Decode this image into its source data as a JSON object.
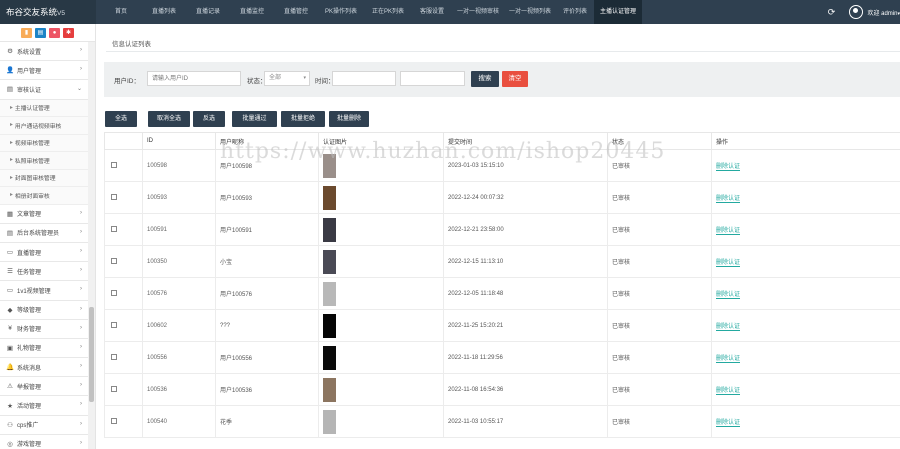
{
  "brand": {
    "name": "布谷交友系统",
    "version": "V5"
  },
  "topnav": [
    {
      "label": "首页",
      "width": 42
    },
    {
      "label": "直播列表",
      "width": 44
    },
    {
      "label": "直播记录",
      "width": 44
    },
    {
      "label": "直播监控",
      "width": 44
    },
    {
      "label": "直播管控",
      "width": 44
    },
    {
      "label": "PK操作列表",
      "width": 46
    },
    {
      "label": "正在PK列表",
      "width": 48
    },
    {
      "label": "客服设置",
      "width": 40
    },
    {
      "label": "一对一视频审核",
      "width": 52
    },
    {
      "label": "一对一视频列表",
      "width": 52
    },
    {
      "label": "评价列表",
      "width": 38
    },
    {
      "label": "主播认证管理",
      "width": 48,
      "active": true
    }
  ],
  "header": {
    "welcome": "欢迎 admin"
  },
  "sidebar": {
    "top_menu": [
      {
        "label": "系统设置",
        "icon": "⚙"
      },
      {
        "label": "用户管理",
        "icon": "👤"
      },
      {
        "label": "审核认证",
        "icon": "▤"
      }
    ],
    "submenu": [
      "主播认证管理",
      "用户通话视频审核",
      "视频审核管理",
      "私照审核管理",
      "封面图审核管理",
      "相册封面审核"
    ],
    "bottom_menu": [
      {
        "label": "文章管理",
        "icon": "▦"
      },
      {
        "label": "后台系统管理员",
        "icon": "▤"
      },
      {
        "label": "直播管理",
        "icon": "▭"
      },
      {
        "label": "任务管理",
        "icon": "☰"
      },
      {
        "label": "1v1视频管理",
        "icon": "▭"
      },
      {
        "label": "等级管理",
        "icon": "◆"
      },
      {
        "label": "财务管理",
        "icon": "¥"
      },
      {
        "label": "礼物管理",
        "icon": "▣"
      },
      {
        "label": "系统消息",
        "icon": "🔔"
      },
      {
        "label": "举报管理",
        "icon": "⚠"
      },
      {
        "label": "活动管理",
        "icon": "★"
      },
      {
        "label": "cps推广",
        "icon": "⚇"
      },
      {
        "label": "游戏管理",
        "icon": "◎"
      }
    ]
  },
  "panel": {
    "title": "信息认证列表"
  },
  "filter": {
    "uid_label": "用户ID：",
    "uid_placeholder": "请输入用户ID",
    "status_label": "状态：",
    "status_value": "全部",
    "time_label": "时间：",
    "search_label": "搜索",
    "clear_label": "清空"
  },
  "actions": [
    "全选",
    "取消全选",
    "反选",
    "批量通过",
    "批量拒绝",
    "批量删除"
  ],
  "table": {
    "headers": [
      "",
      "ID",
      "用户昵称",
      "认证图片",
      "提交时间",
      "状态",
      "操作"
    ],
    "rows": [
      {
        "id": "100598",
        "nick": "用户100598",
        "time": "2023-01-03 15:15:10",
        "status": "已审核",
        "op": "删除认证",
        "thumb": "#9a8f8a"
      },
      {
        "id": "100593",
        "nick": "用户100593",
        "time": "2022-12-24 00:07:32",
        "status": "已审核",
        "op": "删除认证",
        "thumb": "#6b4a2e"
      },
      {
        "id": "100591",
        "nick": "用户100591",
        "time": "2022-12-21 23:58:00",
        "status": "已审核",
        "op": "删除认证",
        "thumb": "#3a3a44"
      },
      {
        "id": "100350",
        "nick": "小宝",
        "time": "2022-12-15 11:13:10",
        "status": "已审核",
        "op": "删除认证",
        "thumb": "#4a4a55"
      },
      {
        "id": "100576",
        "nick": "用户100576",
        "time": "2022-12-05 11:18:48",
        "status": "已审核",
        "op": "删除认证",
        "thumb": "#b8b8b8"
      },
      {
        "id": "100602",
        "nick": "???",
        "time": "2022-11-25 15:20:21",
        "status": "已审核",
        "op": "删除认证",
        "thumb": "#050505"
      },
      {
        "id": "100556",
        "nick": "用户100556",
        "time": "2022-11-18 11:29:56",
        "status": "已审核",
        "op": "删除认证",
        "thumb": "#0a0a0a"
      },
      {
        "id": "100536",
        "nick": "用户100536",
        "time": "2022-11-08 16:54:36",
        "status": "已审核",
        "op": "删除认证",
        "thumb": "#8c7560"
      },
      {
        "id": "100540",
        "nick": "花季",
        "time": "2022-11-03 10:55:17",
        "status": "已审核",
        "op": "删除认证",
        "thumb": "#b5b5b5"
      }
    ]
  },
  "watermark": "https://www.huzhan.com/ishop20445",
  "colors": {
    "nav": "#2f4050",
    "accent_red": "#e94f3f",
    "link": "#23a9a0"
  }
}
